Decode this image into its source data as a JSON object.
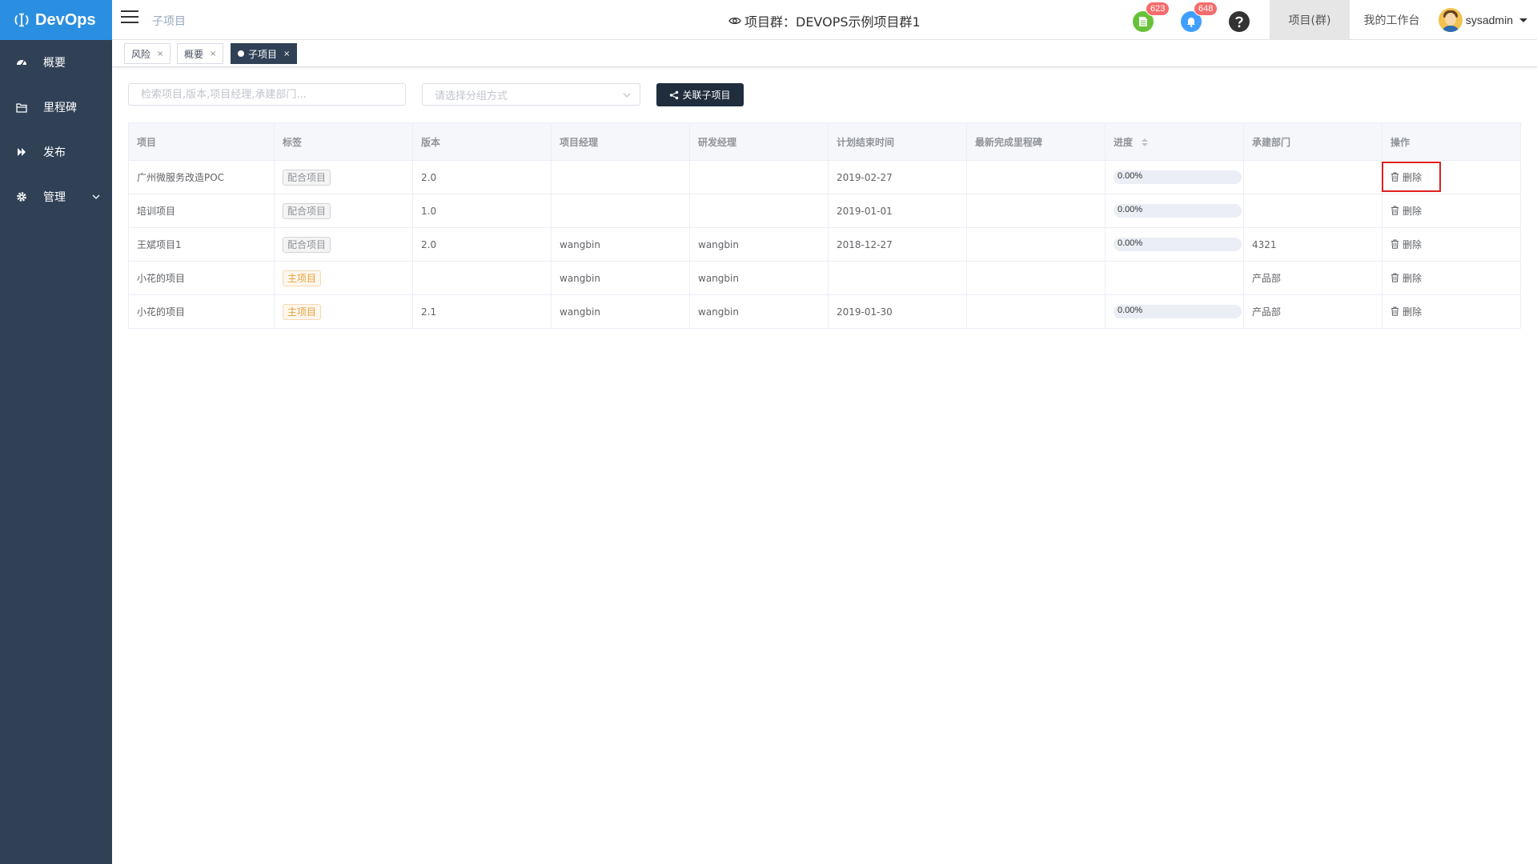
{
  "app": {
    "name": "DevOps"
  },
  "sidebar": {
    "items": [
      {
        "label": "概要",
        "icon": "dashboard-icon"
      },
      {
        "label": "里程碑",
        "icon": "folder-icon"
      },
      {
        "label": "发布",
        "icon": "forward-icon"
      },
      {
        "label": "管理",
        "icon": "gear-icon",
        "has_submenu": true
      }
    ]
  },
  "header": {
    "breadcrumb": "子项目",
    "title": "项目群：DEVOPS示例项目群1",
    "notifications": [
      {
        "icon": "document-icon",
        "count": "623",
        "color": "#67c23a"
      },
      {
        "icon": "bell-icon",
        "count": "648",
        "color": "#409eff"
      }
    ],
    "help_icon": "question-icon",
    "nav_tabs": [
      {
        "label": "项目(群)",
        "active": true
      },
      {
        "label": "我的工作台",
        "active": false
      }
    ],
    "user": {
      "name": "sysadmin"
    }
  },
  "tags_view": {
    "tags": [
      {
        "label": "风险",
        "active": false
      },
      {
        "label": "概要",
        "active": false
      },
      {
        "label": "子项目",
        "active": true
      }
    ]
  },
  "toolbar": {
    "search_placeholder": "检索项目,版本,项目经理,承建部门...",
    "group_select_placeholder": "请选择分组方式",
    "link_button_label": "关联子项目"
  },
  "table": {
    "columns": [
      "项目",
      "标签",
      "版本",
      "项目经理",
      "研发经理",
      "计划结束时间",
      "最新完成里程碑",
      "进度",
      "承建部门",
      "操作"
    ],
    "rows": [
      {
        "project": "广州微服务改造POC",
        "tag": "配合项目",
        "tag_type": "secondary",
        "version": "2.0",
        "pm": "",
        "dev_manager": "",
        "end_date": "2019-02-27",
        "milestone": "",
        "progress": "0.00%",
        "progress_value": 0,
        "department": "",
        "action": "删除"
      },
      {
        "project": "培训项目",
        "tag": "配合项目",
        "tag_type": "secondary",
        "version": "1.0",
        "pm": "",
        "dev_manager": "",
        "end_date": "2019-01-01",
        "milestone": "",
        "progress": "0.00%",
        "progress_value": 0,
        "department": "",
        "action": "删除"
      },
      {
        "project": "王斌项目1",
        "tag": "配合项目",
        "tag_type": "secondary",
        "version": "2.0",
        "pm": "wangbin",
        "dev_manager": "wangbin",
        "end_date": "2018-12-27",
        "milestone": "",
        "progress": "0.00%",
        "progress_value": 0,
        "department": "4321",
        "action": "删除"
      },
      {
        "project": "小花的项目",
        "tag": "主项目",
        "tag_type": "main",
        "version": "",
        "pm": "wangbin",
        "dev_manager": "wangbin",
        "end_date": "",
        "milestone": "",
        "progress": "",
        "progress_value": null,
        "department": "产品部",
        "action": "删除"
      },
      {
        "project": "小花的项目",
        "tag": "主项目",
        "tag_type": "main",
        "version": "2.1",
        "pm": "wangbin",
        "dev_manager": "wangbin",
        "end_date": "2019-01-30",
        "milestone": "",
        "progress": "0.00%",
        "progress_value": 0,
        "department": "产品部",
        "action": "删除"
      }
    ]
  },
  "colors": {
    "sidebar_bg": "#304156",
    "logo_bg": "#2a8fe0",
    "primary_dark": "#1f2d3d",
    "highlight_border": "#e02020"
  }
}
